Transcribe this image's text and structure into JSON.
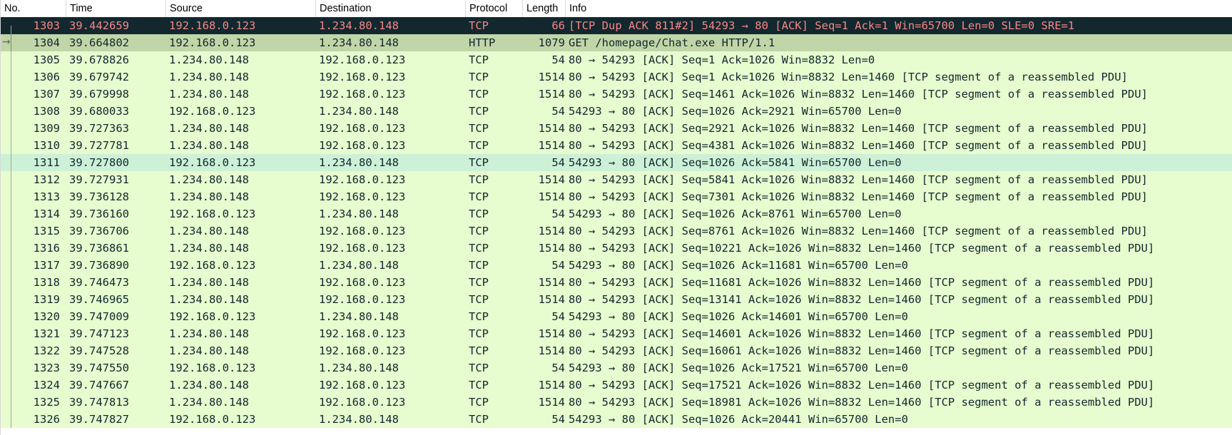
{
  "columns": {
    "no": "No.",
    "time": "Time",
    "source": "Source",
    "destination": "Destination",
    "protocol": "Protocol",
    "length": "Length",
    "info": "Info"
  },
  "colors": {
    "selected_bg": "#12272e",
    "selected_fg": "#f78787",
    "http_bg": "#c1d6a8",
    "tcp_bg": "#e7fdcf",
    "highlight_bg": "#cdf1d7",
    "text": "#12272e"
  },
  "packets": [
    {
      "no": "1303",
      "time": "39.442659",
      "src": "192.168.0.123",
      "dst": "1.234.80.148",
      "proto": "TCP",
      "len": "66",
      "info": "[TCP Dup ACK 811#2] 54293 → 80 [ACK] Seq=1 Ack=1 Win=65700 Len=0 SLE=0 SRE=1",
      "style": "selected"
    },
    {
      "no": "1304",
      "time": "39.664802",
      "src": "192.168.0.123",
      "dst": "1.234.80.148",
      "proto": "HTTP",
      "len": "1079",
      "info": "GET /homepage/Chat.exe HTTP/1.1",
      "style": "http"
    },
    {
      "no": "1305",
      "time": "39.678826",
      "src": "1.234.80.148",
      "dst": "192.168.0.123",
      "proto": "TCP",
      "len": "54",
      "info": "80 → 54293 [ACK] Seq=1 Ack=1026 Win=8832 Len=0",
      "style": "tcp"
    },
    {
      "no": "1306",
      "time": "39.679742",
      "src": "1.234.80.148",
      "dst": "192.168.0.123",
      "proto": "TCP",
      "len": "1514",
      "info": "80 → 54293 [ACK] Seq=1 Ack=1026 Win=8832 Len=1460 [TCP segment of a reassembled PDU]",
      "style": "tcp"
    },
    {
      "no": "1307",
      "time": "39.679998",
      "src": "1.234.80.148",
      "dst": "192.168.0.123",
      "proto": "TCP",
      "len": "1514",
      "info": "80 → 54293 [ACK] Seq=1461 Ack=1026 Win=8832 Len=1460 [TCP segment of a reassembled PDU]",
      "style": "tcp"
    },
    {
      "no": "1308",
      "time": "39.680033",
      "src": "192.168.0.123",
      "dst": "1.234.80.148",
      "proto": "TCP",
      "len": "54",
      "info": "54293 → 80 [ACK] Seq=1026 Ack=2921 Win=65700 Len=0",
      "style": "tcp"
    },
    {
      "no": "1309",
      "time": "39.727363",
      "src": "1.234.80.148",
      "dst": "192.168.0.123",
      "proto": "TCP",
      "len": "1514",
      "info": "80 → 54293 [ACK] Seq=2921 Ack=1026 Win=8832 Len=1460 [TCP segment of a reassembled PDU]",
      "style": "tcp"
    },
    {
      "no": "1310",
      "time": "39.727781",
      "src": "1.234.80.148",
      "dst": "192.168.0.123",
      "proto": "TCP",
      "len": "1514",
      "info": "80 → 54293 [ACK] Seq=4381 Ack=1026 Win=8832 Len=1460 [TCP segment of a reassembled PDU]",
      "style": "tcp"
    },
    {
      "no": "1311",
      "time": "39.727800",
      "src": "192.168.0.123",
      "dst": "1.234.80.148",
      "proto": "TCP",
      "len": "54",
      "info": "54293 → 80 [ACK] Seq=1026 Ack=5841 Win=65700 Len=0",
      "style": "highlight"
    },
    {
      "no": "1312",
      "time": "39.727931",
      "src": "1.234.80.148",
      "dst": "192.168.0.123",
      "proto": "TCP",
      "len": "1514",
      "info": "80 → 54293 [ACK] Seq=5841 Ack=1026 Win=8832 Len=1460 [TCP segment of a reassembled PDU]",
      "style": "tcp"
    },
    {
      "no": "1313",
      "time": "39.736128",
      "src": "1.234.80.148",
      "dst": "192.168.0.123",
      "proto": "TCP",
      "len": "1514",
      "info": "80 → 54293 [ACK] Seq=7301 Ack=1026 Win=8832 Len=1460 [TCP segment of a reassembled PDU]",
      "style": "tcp"
    },
    {
      "no": "1314",
      "time": "39.736160",
      "src": "192.168.0.123",
      "dst": "1.234.80.148",
      "proto": "TCP",
      "len": "54",
      "info": "54293 → 80 [ACK] Seq=1026 Ack=8761 Win=65700 Len=0",
      "style": "tcp"
    },
    {
      "no": "1315",
      "time": "39.736706",
      "src": "1.234.80.148",
      "dst": "192.168.0.123",
      "proto": "TCP",
      "len": "1514",
      "info": "80 → 54293 [ACK] Seq=8761 Ack=1026 Win=8832 Len=1460 [TCP segment of a reassembled PDU]",
      "style": "tcp"
    },
    {
      "no": "1316",
      "time": "39.736861",
      "src": "1.234.80.148",
      "dst": "192.168.0.123",
      "proto": "TCP",
      "len": "1514",
      "info": "80 → 54293 [ACK] Seq=10221 Ack=1026 Win=8832 Len=1460 [TCP segment of a reassembled PDU]",
      "style": "tcp"
    },
    {
      "no": "1317",
      "time": "39.736890",
      "src": "192.168.0.123",
      "dst": "1.234.80.148",
      "proto": "TCP",
      "len": "54",
      "info": "54293 → 80 [ACK] Seq=1026 Ack=11681 Win=65700 Len=0",
      "style": "tcp"
    },
    {
      "no": "1318",
      "time": "39.746473",
      "src": "1.234.80.148",
      "dst": "192.168.0.123",
      "proto": "TCP",
      "len": "1514",
      "info": "80 → 54293 [ACK] Seq=11681 Ack=1026 Win=8832 Len=1460 [TCP segment of a reassembled PDU]",
      "style": "tcp"
    },
    {
      "no": "1319",
      "time": "39.746965",
      "src": "1.234.80.148",
      "dst": "192.168.0.123",
      "proto": "TCP",
      "len": "1514",
      "info": "80 → 54293 [ACK] Seq=13141 Ack=1026 Win=8832 Len=1460 [TCP segment of a reassembled PDU]",
      "style": "tcp"
    },
    {
      "no": "1320",
      "time": "39.747009",
      "src": "192.168.0.123",
      "dst": "1.234.80.148",
      "proto": "TCP",
      "len": "54",
      "info": "54293 → 80 [ACK] Seq=1026 Ack=14601 Win=65700 Len=0",
      "style": "tcp"
    },
    {
      "no": "1321",
      "time": "39.747123",
      "src": "1.234.80.148",
      "dst": "192.168.0.123",
      "proto": "TCP",
      "len": "1514",
      "info": "80 → 54293 [ACK] Seq=14601 Ack=1026 Win=8832 Len=1460 [TCP segment of a reassembled PDU]",
      "style": "tcp"
    },
    {
      "no": "1322",
      "time": "39.747528",
      "src": "1.234.80.148",
      "dst": "192.168.0.123",
      "proto": "TCP",
      "len": "1514",
      "info": "80 → 54293 [ACK] Seq=16061 Ack=1026 Win=8832 Len=1460 [TCP segment of a reassembled PDU]",
      "style": "tcp"
    },
    {
      "no": "1323",
      "time": "39.747550",
      "src": "192.168.0.123",
      "dst": "1.234.80.148",
      "proto": "TCP",
      "len": "54",
      "info": "54293 → 80 [ACK] Seq=1026 Ack=17521 Win=65700 Len=0",
      "style": "tcp"
    },
    {
      "no": "1324",
      "time": "39.747667",
      "src": "1.234.80.148",
      "dst": "192.168.0.123",
      "proto": "TCP",
      "len": "1514",
      "info": "80 → 54293 [ACK] Seq=17521 Ack=1026 Win=8832 Len=1460 [TCP segment of a reassembled PDU]",
      "style": "tcp"
    },
    {
      "no": "1325",
      "time": "39.747813",
      "src": "1.234.80.148",
      "dst": "192.168.0.123",
      "proto": "TCP",
      "len": "1514",
      "info": "80 → 54293 [ACK] Seq=18981 Ack=1026 Win=8832 Len=1460 [TCP segment of a reassembled PDU]",
      "style": "tcp"
    },
    {
      "no": "1326",
      "time": "39.747827",
      "src": "192.168.0.123",
      "dst": "1.234.80.148",
      "proto": "TCP",
      "len": "54",
      "info": "54293 → 80 [ACK] Seq=1026 Ack=20441 Win=65700 Len=0",
      "style": "tcp"
    }
  ]
}
